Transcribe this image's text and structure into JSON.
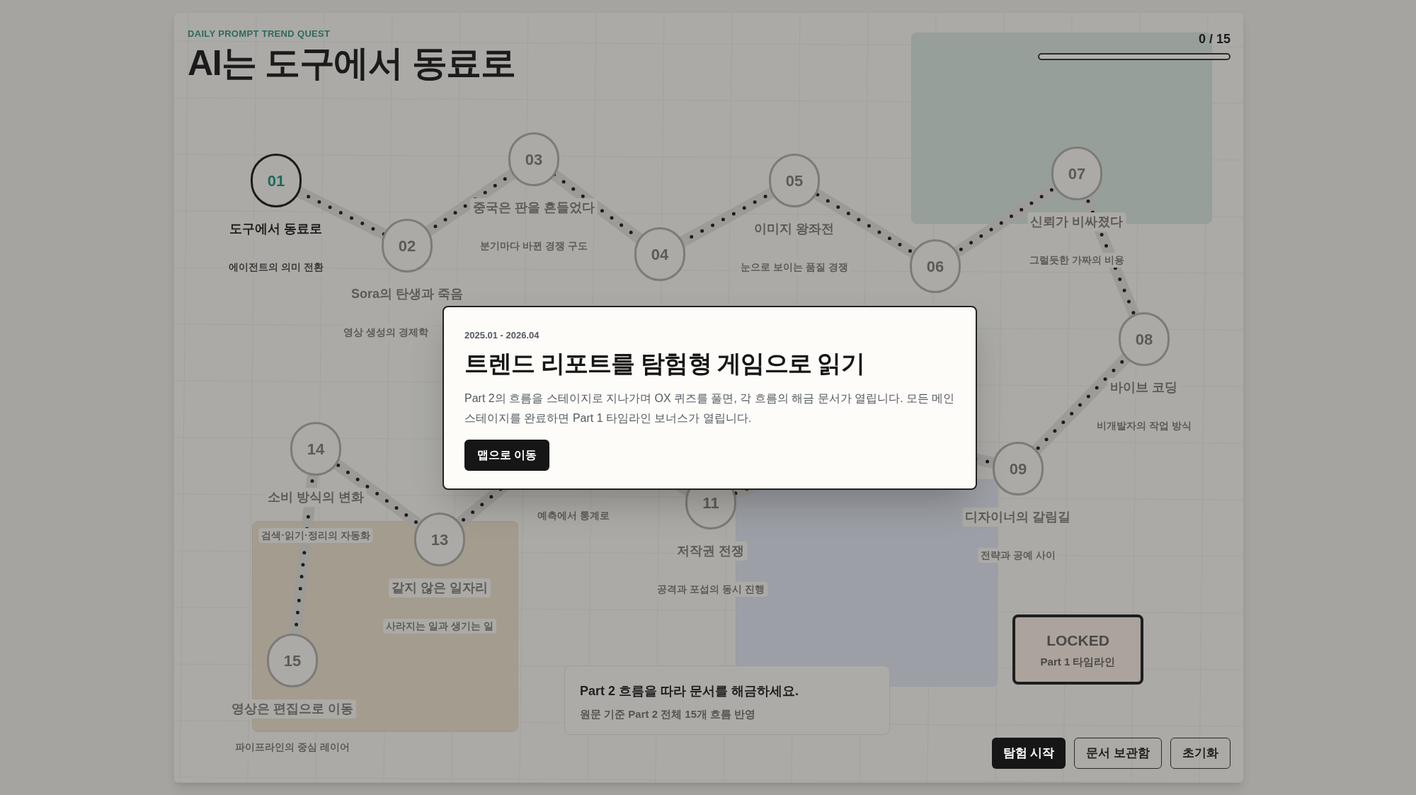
{
  "header": {
    "eyebrow": "DAILY PROMPT TREND QUEST",
    "title": "AI는 도구에서 동료로"
  },
  "progress": {
    "reading": "0 / 15",
    "level": 0
  },
  "stages": [
    {
      "number": "01",
      "title": "도구에서 동료로",
      "subtitle": "에이전트의 의미 전환",
      "current": true
    },
    {
      "number": "02",
      "title": "Sora의 탄생과 죽음",
      "subtitle": "영상 생성의 경제학",
      "current": false
    },
    {
      "number": "03",
      "title": "중국은 판을 흔들었다",
      "subtitle": "분기마다 바뀐 경쟁 구도",
      "current": false
    },
    {
      "number": "04",
      "current": false
    },
    {
      "number": "05",
      "title": "이미지 왕좌전",
      "subtitle": "눈으로 보이는 품질 경쟁",
      "current": false
    },
    {
      "number": "06",
      "current": false
    },
    {
      "number": "07",
      "title": "신뢰가 비싸졌다",
      "subtitle": "그럴듯한 가짜의 비용",
      "current": false
    },
    {
      "number": "08",
      "title": "바이브 코딩",
      "subtitle": "비개발자의 작업 방식",
      "current": false
    },
    {
      "number": "09",
      "title": "디자이너의 갈림길",
      "subtitle": "전략과 공예 사이",
      "current": false
    },
    {
      "number": "11",
      "title": "저작권 전쟁",
      "subtitle": "공격과 포섭의 동시 진행",
      "current": false
    },
    {
      "subtitle": "예측에서 통계로",
      "current": false
    },
    {
      "number": "13",
      "title": "같지 않은 일자리",
      "subtitle": "사라지는 일과 생기는 일",
      "current": false
    },
    {
      "number": "14",
      "title": "소비 방식의 변화",
      "subtitle": "검색·읽기·정리의 자동화",
      "current": false
    },
    {
      "number": "15",
      "title": "영상은 편집으로 이동",
      "subtitle": "파이프라인의 중심 레이어",
      "current": false
    }
  ],
  "notice": {
    "title": "Part 2 흐름을 따라 문서를 해금하세요.",
    "subtitle": "원문 기준 Part 2 전체 15개 흐름 반영"
  },
  "locked_stage": {
    "title": "LOCKED",
    "subtitle": "Part 1 타임라인"
  },
  "buttons": [
    {
      "label": "탐험 시작",
      "primary": true
    },
    {
      "label": "문서 보관함",
      "primary": false
    },
    {
      "label": "초기화",
      "primary": false
    }
  ],
  "modal": {
    "date": "2025.01 - 2026.04",
    "title": "트렌드 리포트를 탐험형 게임으로 읽기",
    "body": "Part 2의 흐름을 스테이지로 지나가며 OX 퀴즈를 풀면, 각 흐름의 해금 문서가 열립니다. 모든 메인 스테이지를 완료하면 Part 1 타임라인 보너스가 열립니다.",
    "button": "맵으로 이동"
  }
}
